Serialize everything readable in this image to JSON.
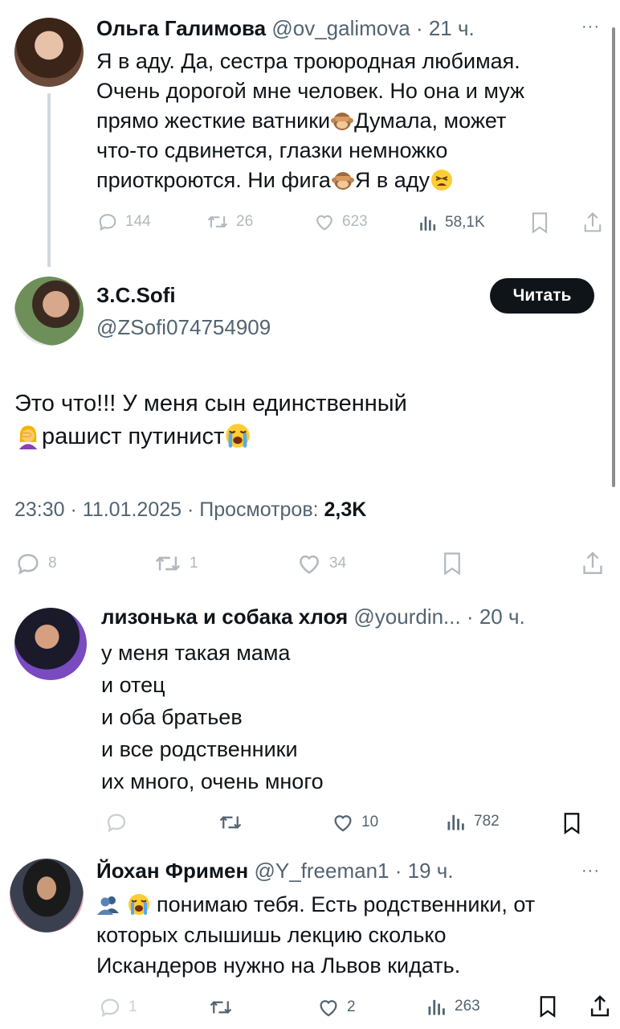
{
  "tweets": [
    {
      "author_name": "Ольга Галимова",
      "handle": "@ov_galimova",
      "time": "· 21 ч.",
      "lines": [
        "Я в аду. Да, сестра троюродная любимая.",
        "Очень дорогой мне человек. Но она и муж",
        "прямо жесткие ватники",
        "Думала, может",
        "что-то сдвинется, глазки немножко",
        "приоткроются. Ни фига",
        "Я в аду"
      ],
      "stats": {
        "replies": "144",
        "retweets": "26",
        "likes": "623",
        "views": "58,1K"
      },
      "more": "···"
    },
    {
      "author_name": "З.С.Sofi",
      "handle": "@ZSofi074754909",
      "follow_label": "Читать",
      "lines": [
        "Это что!!! У меня сын единственный",
        "рашист путинист"
      ],
      "timestamp": "23:30 · 11.01.2025 · Просмотров:",
      "views_value": "2,3K",
      "stats": {
        "replies": "8",
        "retweets": "1",
        "likes": "34"
      }
    },
    {
      "author_name": "лизонька и собака хлоя",
      "handle": "@yourdin...",
      "time": "· 20 ч.",
      "lines": [
        "у меня такая мама",
        "и отец",
        "и оба братьев",
        "и все родственники",
        "их много, очень много"
      ],
      "stats": {
        "likes": "10",
        "views": "782"
      }
    },
    {
      "author_name": "Йохан Фримен",
      "handle": "@Y_freeman1",
      "time": "· 19 ч.",
      "lines": [
        "понимаю тебя. Есть родственники, от",
        "которых слышишь лекцию сколько",
        "Искандеров нужно на Львов кидать."
      ],
      "stats": {
        "replies": "1",
        "likes": "2",
        "views": "263"
      },
      "more": "···"
    }
  ],
  "icons": [
    "reply-icon",
    "retweet-icon",
    "like-icon",
    "views-icon",
    "bookmark-icon",
    "share-icon",
    "see-no-evil-monkey-emoji",
    "tired-face-emoji",
    "woman-facepalming-emoji",
    "loudly-crying-face-emoji",
    "busts-in-silhouette-emoji"
  ],
  "colors": {
    "text": "#0f1419",
    "muted": "#536471",
    "thread_line": "#cfd9de",
    "button": "#0f1419"
  }
}
